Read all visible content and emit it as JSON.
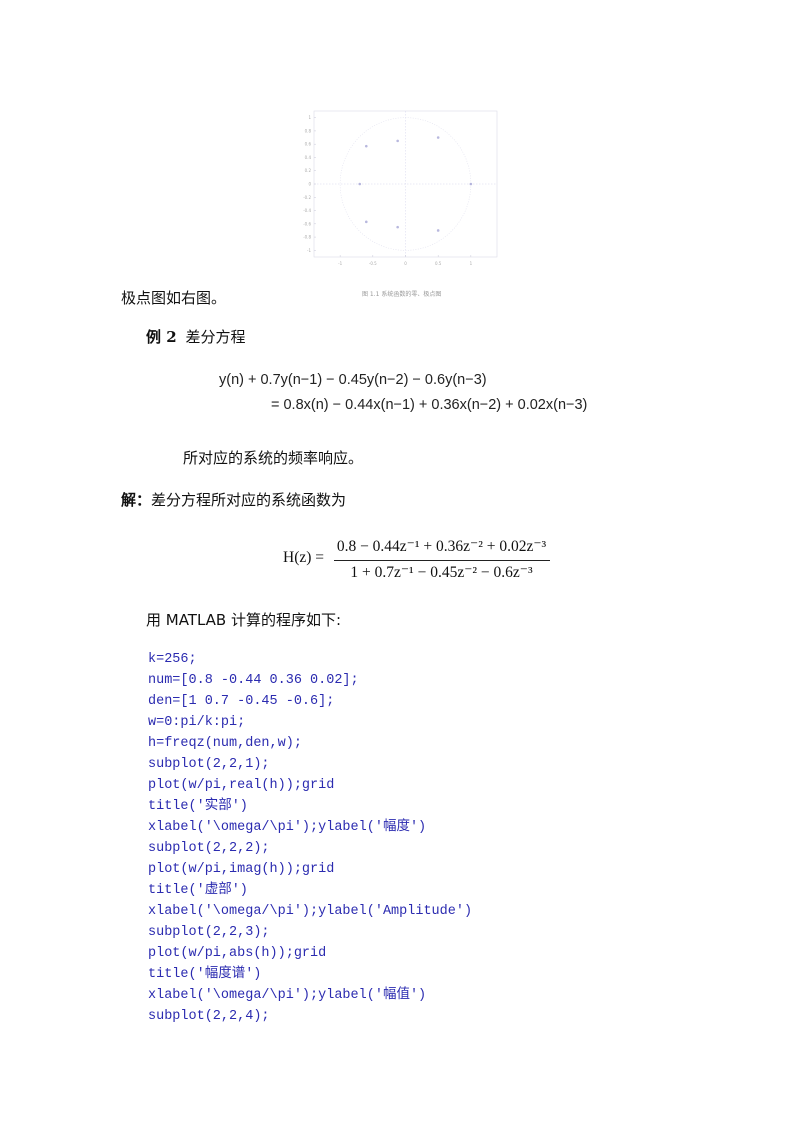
{
  "figure": {
    "caption": "图 1.1  系统函数的零、极点图",
    "chart_data": {
      "type": "scatter",
      "title": "",
      "xlabel": "",
      "ylabel": "",
      "xlim": [
        -1.4,
        1.4
      ],
      "ylim": [
        -1.1,
        1.1
      ],
      "xticks": [
        "-1",
        "-0.5",
        "0",
        "0.5",
        "1"
      ],
      "xtick_values": [
        -1,
        -0.5,
        0,
        0.5,
        1
      ],
      "yticks": [
        "1",
        "0.8",
        "0.6",
        "0.4",
        "0.2",
        "0",
        "-0.2",
        "-0.4",
        "-0.6",
        "-0.8",
        "-1"
      ],
      "ytick_values": [
        1,
        0.8,
        0.6,
        0.4,
        0.2,
        0,
        -0.2,
        -0.4,
        -0.6,
        -0.8,
        -1
      ],
      "unit_circle": true,
      "series": [
        {
          "name": "points",
          "x": [
            -0.7,
            -0.6,
            -0.12,
            0.5,
            1.0,
            -0.6,
            -0.12,
            0.5
          ],
          "y": [
            0,
            0.57,
            0.65,
            0.7,
            0,
            -0.57,
            -0.65,
            -0.7
          ]
        }
      ]
    }
  },
  "para1": "极点图如右图。",
  "example": {
    "label": "例 2",
    "title": "差分方程"
  },
  "equation": {
    "line1": "y(n) + 0.7y(n−1) − 0.45y(n−2) − 0.6y(n−3)",
    "line2": "= 0.8x(n) − 0.44x(n−1) + 0.36x(n−2) + 0.02x(n−3)"
  },
  "para2": "所对应的系统的频率响应。",
  "solution": {
    "label": "解：",
    "text": "差分方程所对应的系统函数为"
  },
  "transfer_function": {
    "lhs": "H(z) =",
    "numerator": "0.8 − 0.44z⁻¹ + 0.36z⁻² + 0.02z⁻³",
    "denominator": "1 + 0.7z⁻¹ − 0.45z⁻² − 0.6z⁻³"
  },
  "para3": "用 MATLAB 计算的程序如下:",
  "code_lines": [
    "k=256;",
    "num=[0.8 -0.44 0.36 0.02];",
    "den=[1 0.7 -0.45 -0.6];",
    "w=0:pi/k:pi;",
    "h=freqz(num,den,w);",
    "subplot(2,2,1);",
    "plot(w/pi,real(h));grid",
    "title('实部')",
    "xlabel('\\omega/\\pi');ylabel('幅度')",
    "subplot(2,2,2);",
    "plot(w/pi,imag(h));grid",
    "title('虚部')",
    "xlabel('\\omega/\\pi');ylabel('Amplitude')",
    "subplot(2,2,3);",
    "plot(w/pi,abs(h));grid",
    "title('幅度谱')",
    "xlabel('\\omega/\\pi');ylabel('幅值')",
    "subplot(2,2,4);"
  ],
  "colors": {
    "code": "#2b2bb0",
    "plot_axis": "#c8c8d8",
    "plot_point": "#9a9ad0"
  }
}
